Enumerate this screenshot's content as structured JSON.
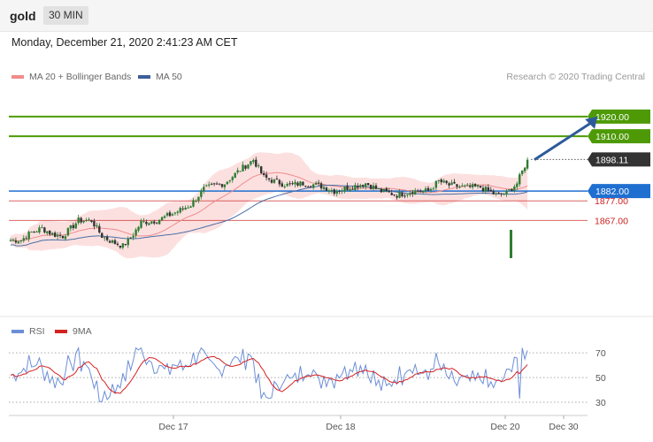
{
  "header": {
    "symbol": "gold",
    "timeframe": "30 MIN",
    "datetime": "Monday, December 21, 2020 2:41:23 AM CET"
  },
  "legend": {
    "ma20_label": "MA 20 + Bollinger Bands",
    "ma50_label": "MA 50",
    "credit": "Research © 2020 Trading Central"
  },
  "rsi_legend": {
    "rsi_label": "RSI",
    "ma9_label": "9MA"
  },
  "colors": {
    "up": "#2e7d32",
    "down": "#333333",
    "ma20": "#f08c8c",
    "ma50": "#4a6fa5",
    "band": "#fbdada",
    "target": "#4d9a06",
    "pivot": "#1f6fd1",
    "support": "#cc2222",
    "arrow": "#2d5b9a",
    "rsi": "#6c8fd6",
    "rsi_ma": "#d62020"
  },
  "chart_data": [
    {
      "type": "candlestick",
      "title": "gold",
      "timeframe": "30 MIN",
      "ylim": [
        1818,
        1938
      ],
      "x_tick_labels": [
        "Dec 17",
        "Dec 18",
        "Dec 20",
        "Dec 30"
      ],
      "levels": [
        {
          "label": "1920.00",
          "value": 1920.0,
          "kind": "target"
        },
        {
          "label": "1910.00",
          "value": 1910.0,
          "kind": "target"
        },
        {
          "label": "1898.11",
          "value": 1898.11,
          "kind": "last_price"
        },
        {
          "label": "1882.00",
          "value": 1882.0,
          "kind": "pivot"
        },
        {
          "label": "1877.00",
          "value": 1877.0,
          "kind": "support"
        },
        {
          "label": "1867.00",
          "value": 1867.0,
          "kind": "support"
        }
      ],
      "path_anchors": [
        [
          0,
          1857
        ],
        [
          4,
          1857
        ],
        [
          8,
          1861
        ],
        [
          12,
          1863
        ],
        [
          16,
          1860
        ],
        [
          20,
          1859
        ],
        [
          26,
          1867
        ],
        [
          31,
          1867
        ],
        [
          35,
          1859
        ],
        [
          39,
          1856
        ],
        [
          43,
          1854
        ],
        [
          46,
          1858
        ],
        [
          50,
          1866
        ],
        [
          56,
          1867
        ],
        [
          63,
          1871
        ],
        [
          69,
          1875
        ],
        [
          74,
          1883
        ],
        [
          78,
          1885
        ],
        [
          82,
          1886
        ],
        [
          88,
          1893
        ],
        [
          93,
          1898
        ],
        [
          97,
          1889
        ],
        [
          101,
          1887
        ],
        [
          106,
          1885
        ],
        [
          112,
          1886
        ],
        [
          118,
          1885
        ],
        [
          124,
          1882
        ],
        [
          130,
          1884
        ],
        [
          136,
          1886
        ],
        [
          142,
          1882
        ],
        [
          148,
          1880
        ],
        [
          154,
          1882
        ],
        [
          160,
          1882
        ],
        [
          164,
          1887
        ],
        [
          168,
          1885
        ],
        [
          174,
          1884
        ],
        [
          180,
          1884
        ],
        [
          186,
          1880
        ],
        [
          190,
          1881
        ],
        [
          194,
          1886
        ],
        [
          198,
          1898
        ]
      ],
      "arrow": {
        "from": [
          198,
          1898
        ],
        "to": [
          218,
          1920
        ]
      }
    },
    {
      "type": "line",
      "title": "RSI",
      "ylim": [
        25,
        78
      ],
      "y_ticks": [
        70,
        50,
        30
      ],
      "series": [
        {
          "name": "RSI"
        },
        {
          "name": "9MA"
        }
      ]
    }
  ]
}
